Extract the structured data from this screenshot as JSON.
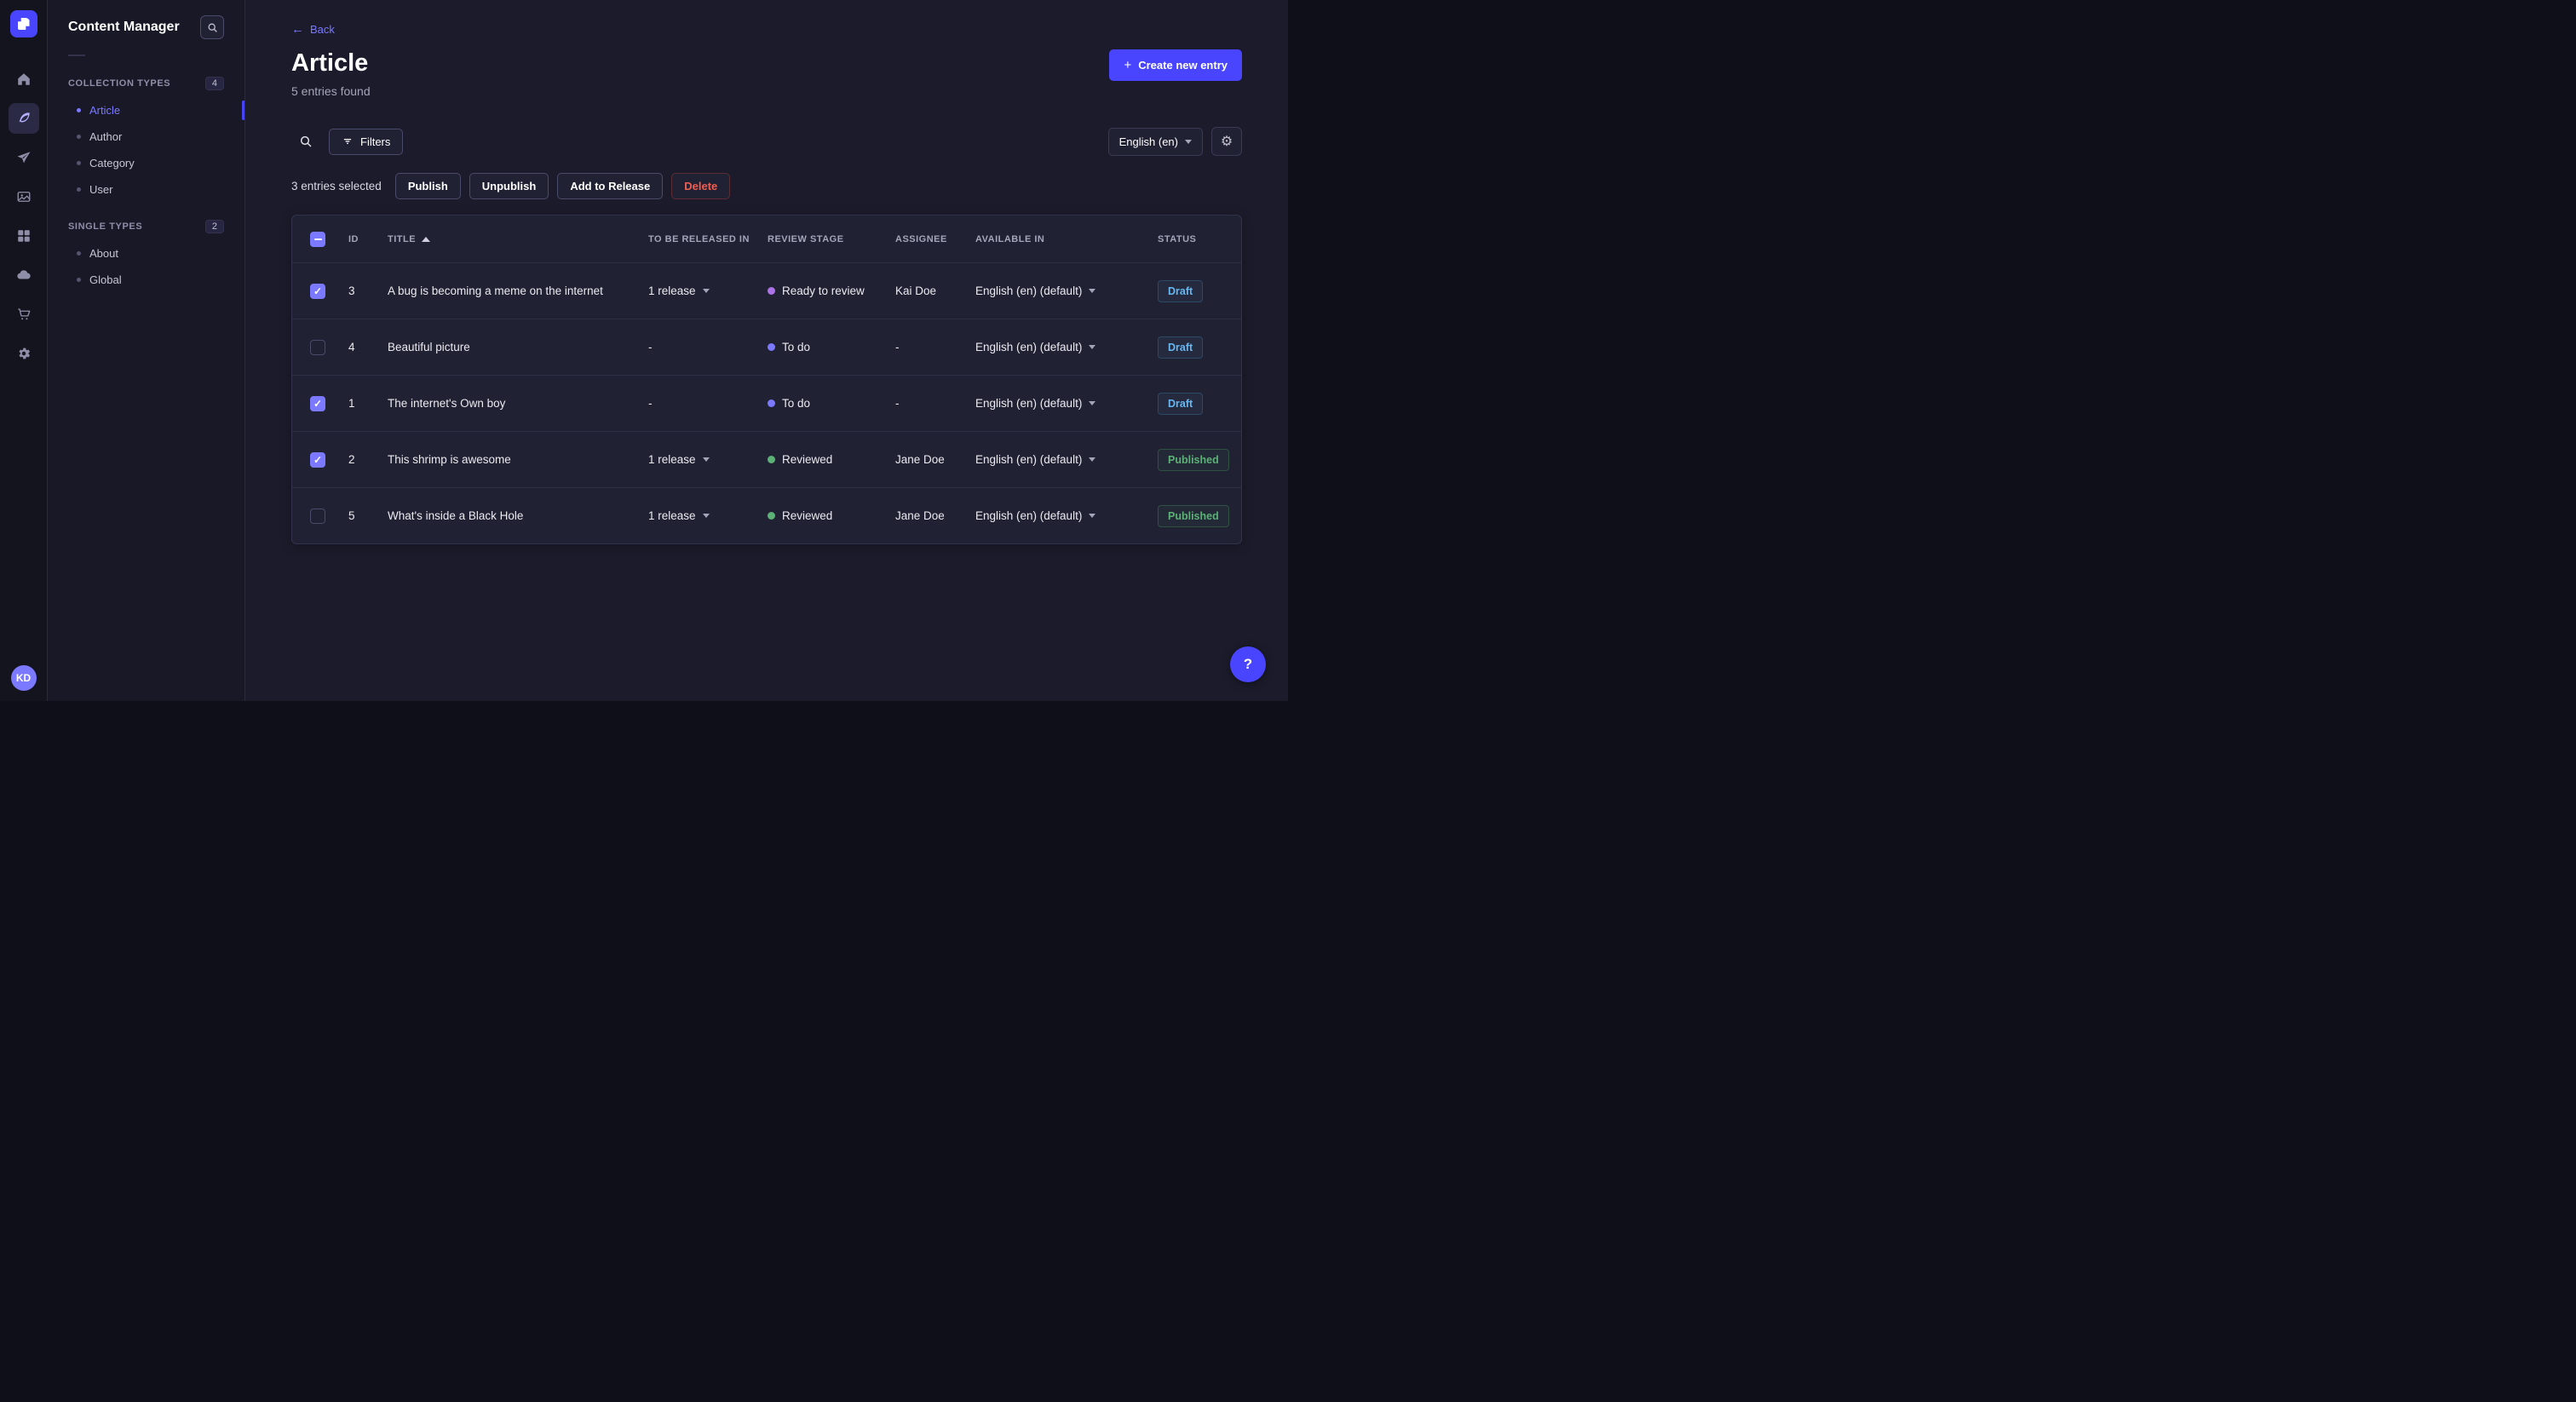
{
  "rail": {
    "avatar": "KD",
    "icons": [
      "home-icon",
      "content-manager-icon",
      "releases-icon",
      "media-library-icon",
      "content-type-builder-icon",
      "deploy-cloud-icon",
      "marketplace-icon",
      "settings-icon"
    ]
  },
  "sidebar": {
    "title": "Content Manager",
    "sections": [
      {
        "label": "COLLECTION TYPES",
        "badge": "4",
        "items": [
          {
            "label": "Article",
            "active": true
          },
          {
            "label": "Author",
            "active": false
          },
          {
            "label": "Category",
            "active": false
          },
          {
            "label": "User",
            "active": false
          }
        ]
      },
      {
        "label": "SINGLE TYPES",
        "badge": "2",
        "items": [
          {
            "label": "About",
            "active": false
          },
          {
            "label": "Global",
            "active": false
          }
        ]
      }
    ]
  },
  "header": {
    "back": "Back",
    "title": "Article",
    "subtitle": "5 entries found",
    "create": "Create new entry"
  },
  "toolbar": {
    "filters": "Filters",
    "locale": "English (en)"
  },
  "selection": {
    "text": "3 entries selected",
    "publish": "Publish",
    "unpublish": "Unpublish",
    "add_to_release": "Add to Release",
    "delete": "Delete"
  },
  "table": {
    "headers": {
      "id": "ID",
      "title": "TITLE",
      "release": "TO BE RELEASED IN",
      "stage": "REVIEW STAGE",
      "assignee": "ASSIGNEE",
      "available": "AVAILABLE IN",
      "status": "STATUS"
    },
    "rows": [
      {
        "checked": true,
        "id": "3",
        "title": "A bug is becoming a meme on the internet",
        "release": "1 release",
        "release_caret": true,
        "stage": "Ready to review",
        "stage_color": "#ac73e8",
        "assignee": "Kai Doe",
        "locale": "English (en) (default)",
        "status": "Draft",
        "status_kind": "draft"
      },
      {
        "checked": false,
        "id": "4",
        "title": "Beautiful picture",
        "release": "-",
        "release_caret": false,
        "stage": "To do",
        "stage_color": "#7b79ff",
        "assignee": "-",
        "locale": "English (en) (default)",
        "status": "Draft",
        "status_kind": "draft"
      },
      {
        "checked": true,
        "id": "1",
        "title": "The internet's Own boy",
        "release": "-",
        "release_caret": false,
        "stage": "To do",
        "stage_color": "#7b79ff",
        "assignee": "-",
        "locale": "English (en) (default)",
        "status": "Draft",
        "status_kind": "draft"
      },
      {
        "checked": true,
        "id": "2",
        "title": "This shrimp is awesome",
        "release": "1 release",
        "release_caret": true,
        "stage": "Reviewed",
        "stage_color": "#5cb176",
        "assignee": "Jane Doe",
        "locale": "English (en) (default)",
        "status": "Published",
        "status_kind": "published"
      },
      {
        "checked": false,
        "id": "5",
        "title": "What's inside a Black Hole",
        "release": "1 release",
        "release_caret": true,
        "stage": "Reviewed",
        "stage_color": "#5cb176",
        "assignee": "Jane Doe",
        "locale": "English (en) (default)",
        "status": "Published",
        "status_kind": "published"
      }
    ]
  },
  "colors": {
    "accent": "#4945ff",
    "active_link": "#7b79ff",
    "draft": "#66b7f1",
    "published": "#5cb176",
    "danger": "#ee5e52"
  }
}
